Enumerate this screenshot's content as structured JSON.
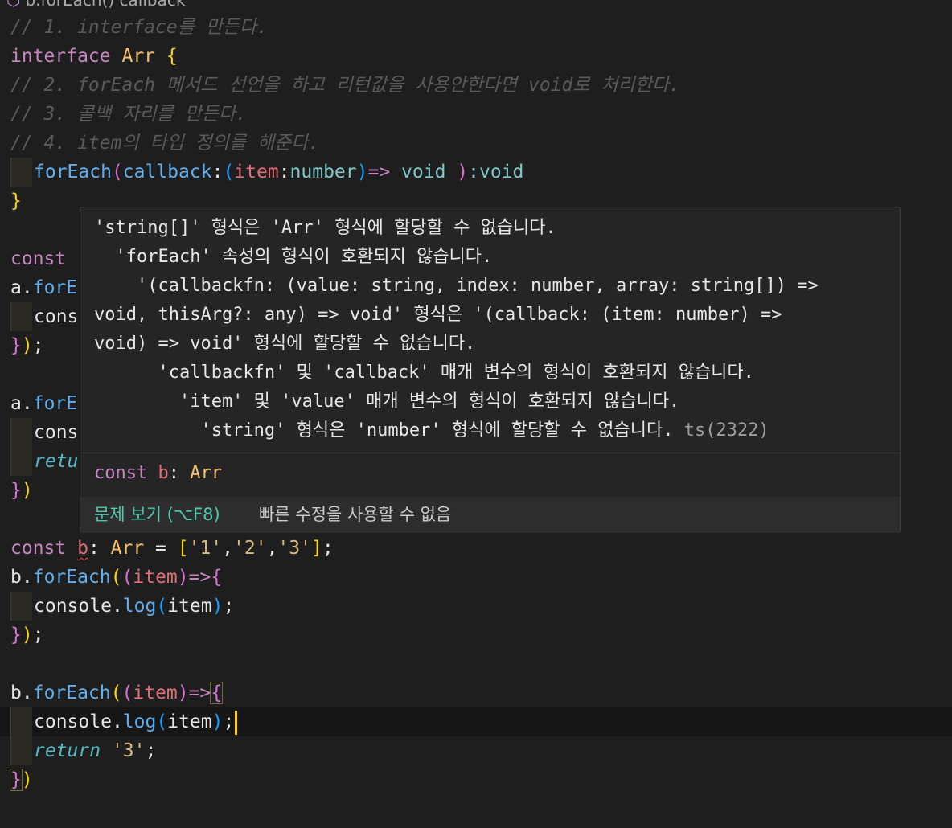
{
  "breadcrumb": {
    "icon": "cube-icon",
    "label": "b.forEach() callback"
  },
  "code_lines": [
    {
      "segments": [
        {
          "t": "// 1. interface를 만든다.",
          "c": "c-comment"
        }
      ]
    },
    {
      "segments": [
        {
          "t": "interface ",
          "c": "c-kw"
        },
        {
          "t": "Arr",
          "c": "c-type"
        },
        {
          "t": " ",
          "c": "c-plain"
        },
        {
          "t": "{",
          "c": "c-br1"
        }
      ]
    },
    {
      "segments": [
        {
          "t": "// 2. forEach 메서드 선언을 하고 리턴값을 사용안한다면 void로 처리한다.",
          "c": "c-comment"
        }
      ]
    },
    {
      "segments": [
        {
          "t": "// 3. 콜백 자리를 만든다.",
          "c": "c-comment"
        }
      ]
    },
    {
      "segments": [
        {
          "t": "// 4. item의 타입 정의를 해준다.",
          "c": "c-comment"
        }
      ]
    },
    {
      "indent": true,
      "segments": [
        {
          "t": "forEach",
          "c": "c-fn"
        },
        {
          "t": "(",
          "c": "c-br2"
        },
        {
          "t": "callback",
          "c": "c-fn"
        },
        {
          "t": ":",
          "c": "c-plain"
        },
        {
          "t": "(",
          "c": "c-br3"
        },
        {
          "t": "item",
          "c": "c-param"
        },
        {
          "t": ":",
          "c": "c-plain"
        },
        {
          "t": "number",
          "c": "c-void"
        },
        {
          "t": ")",
          "c": "c-br3"
        },
        {
          "t": "=>",
          "c": "c-kw"
        },
        {
          "t": " void ",
          "c": "c-void"
        },
        {
          "t": ")",
          "c": "c-br2"
        },
        {
          "t": ":void",
          "c": "c-void"
        }
      ]
    },
    {
      "segments": [
        {
          "t": "}",
          "c": "c-br1"
        }
      ]
    },
    {
      "segments": [
        {
          "t": "",
          "c": "c-plain"
        }
      ]
    },
    {
      "segments": [
        {
          "t": "const",
          "c": "c-kw"
        }
      ]
    },
    {
      "segments": [
        {
          "t": "a",
          "c": "c-plain"
        },
        {
          "t": ".",
          "c": "c-plain"
        },
        {
          "t": "forE",
          "c": "c-fn"
        }
      ]
    },
    {
      "indent": true,
      "segments": [
        {
          "t": "cons",
          "c": "c-plain"
        }
      ]
    },
    {
      "segments": [
        {
          "t": "}",
          "c": "c-br2"
        },
        {
          "t": ")",
          "c": "c-br1"
        },
        {
          "t": ";",
          "c": "c-plain"
        }
      ]
    },
    {
      "segments": [
        {
          "t": "",
          "c": "c-plain"
        }
      ]
    },
    {
      "segments": [
        {
          "t": "a",
          "c": "c-plain"
        },
        {
          "t": ".",
          "c": "c-plain"
        },
        {
          "t": "forE",
          "c": "c-fn"
        }
      ]
    },
    {
      "indent": true,
      "segments": [
        {
          "t": "cons",
          "c": "c-plain"
        }
      ]
    },
    {
      "indent": true,
      "segments": [
        {
          "t": "retu",
          "c": "c-ret"
        }
      ]
    },
    {
      "segments": [
        {
          "t": "}",
          "c": "c-br2"
        },
        {
          "t": ")",
          "c": "c-br1"
        }
      ]
    },
    {
      "segments": [
        {
          "t": "",
          "c": "c-plain"
        }
      ]
    },
    {
      "segments": [
        {
          "t": "const ",
          "c": "c-kw"
        },
        {
          "t": "b",
          "c": "c-param",
          "squiggle": true
        },
        {
          "t": ": ",
          "c": "c-plain"
        },
        {
          "t": "Arr",
          "c": "c-type"
        },
        {
          "t": " = ",
          "c": "c-plain"
        },
        {
          "t": "[",
          "c": "c-br1"
        },
        {
          "t": "'1'",
          "c": "c-str"
        },
        {
          "t": ",",
          "c": "c-plain"
        },
        {
          "t": "'2'",
          "c": "c-str"
        },
        {
          "t": ",",
          "c": "c-plain"
        },
        {
          "t": "'3'",
          "c": "c-str"
        },
        {
          "t": "]",
          "c": "c-br1"
        },
        {
          "t": ";",
          "c": "c-plain"
        }
      ]
    },
    {
      "segments": [
        {
          "t": "b",
          "c": "c-plain"
        },
        {
          "t": ".",
          "c": "c-plain"
        },
        {
          "t": "forEach",
          "c": "c-fn"
        },
        {
          "t": "(",
          "c": "c-br1"
        },
        {
          "t": "(",
          "c": "c-br2"
        },
        {
          "t": "item",
          "c": "c-param"
        },
        {
          "t": ")",
          "c": "c-br2"
        },
        {
          "t": "=>",
          "c": "c-kw"
        },
        {
          "t": "{",
          "c": "c-br2"
        }
      ]
    },
    {
      "indent": true,
      "segments": [
        {
          "t": "console",
          "c": "c-plain"
        },
        {
          "t": ".",
          "c": "c-plain"
        },
        {
          "t": "log",
          "c": "c-fn"
        },
        {
          "t": "(",
          "c": "c-br3"
        },
        {
          "t": "item",
          "c": "c-plain"
        },
        {
          "t": ")",
          "c": "c-br3"
        },
        {
          "t": ";",
          "c": "c-plain"
        }
      ]
    },
    {
      "segments": [
        {
          "t": "}",
          "c": "c-br2"
        },
        {
          "t": ")",
          "c": "c-br1"
        },
        {
          "t": ";",
          "c": "c-plain"
        }
      ]
    },
    {
      "segments": [
        {
          "t": "",
          "c": "c-plain"
        }
      ]
    },
    {
      "segments": [
        {
          "t": "b",
          "c": "c-plain"
        },
        {
          "t": ".",
          "c": "c-plain"
        },
        {
          "t": "forEach",
          "c": "c-fn"
        },
        {
          "t": "(",
          "c": "c-br1"
        },
        {
          "t": "(",
          "c": "c-br2"
        },
        {
          "t": "item",
          "c": "c-param"
        },
        {
          "t": ")",
          "c": "c-br2"
        },
        {
          "t": "=>",
          "c": "c-kw"
        },
        {
          "t": "{",
          "c": "c-br2",
          "box": true
        }
      ]
    },
    {
      "indent": true,
      "current": true,
      "cursor": true,
      "segments": [
        {
          "t": "console",
          "c": "c-plain"
        },
        {
          "t": ".",
          "c": "c-plain"
        },
        {
          "t": "log",
          "c": "c-fn"
        },
        {
          "t": "(",
          "c": "c-br3"
        },
        {
          "t": "item",
          "c": "c-plain"
        },
        {
          "t": ")",
          "c": "c-br3"
        },
        {
          "t": ";",
          "c": "c-plain"
        }
      ]
    },
    {
      "indent": true,
      "segments": [
        {
          "t": "return ",
          "c": "c-ret"
        },
        {
          "t": "'3'",
          "c": "c-str"
        },
        {
          "t": ";",
          "c": "c-plain"
        }
      ]
    },
    {
      "segments": [
        {
          "t": "}",
          "c": "c-br2",
          "box": true
        },
        {
          "t": ")",
          "c": "c-br1"
        }
      ]
    }
  ],
  "hover": {
    "message_lines": [
      "'string[]' 형식은 'Arr' 형식에 할당할 수 없습니다.",
      "  'forEach' 속성의 형식이 호환되지 않습니다.",
      "    '(callbackfn: (value: string, index: number, array: string[]) =>",
      "void, thisArg?: any) => void' 형식은 '(callback: (item: number) =>",
      "void) => void' 형식에 할당할 수 없습니다.",
      "      'callbackfn' 및 'callback' 매개 변수의 형식이 호환되지 않습니다.",
      "        'item' 및 'value' 매개 변수의 형식이 호환되지 않습니다.",
      "          'string' 형식은 'number' 형식에 할당할 수 없습니다."
    ],
    "error_code": "ts(2322)",
    "declaration": {
      "keyword": "const",
      "name": "b",
      "colon": ":",
      "type": "Arr"
    },
    "status": {
      "view_problem": "문제 보기 (⌥F8)",
      "no_quick_fix": "빠른 수정을 사용할 수 없음"
    }
  }
}
